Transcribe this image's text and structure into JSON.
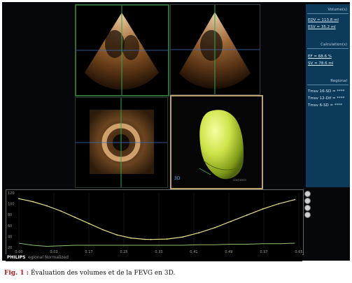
{
  "side_panel": {
    "volumes_title": "Volume(s)",
    "edv": "EDV = 113.8 ml",
    "esv": "ESV = 35.2 ml",
    "calc_title": "Calculation(s)",
    "ef": "EF = 68.6 %",
    "sv": "SV = 78.6 ml",
    "regional_title": "Regional",
    "regional_rows": [
      "Tmsv 16-SD = ****",
      "Tmsv 12-Dif = ****",
      "Tmsv 6-SD = ****"
    ]
  },
  "view_3d_label": "3D",
  "plot": {
    "y_ticks": [
      "120",
      "100",
      "80",
      "60",
      "40",
      "20"
    ],
    "x_ticks": [
      "0.00",
      "0.03",
      "0.17",
      "0.25",
      "0.33",
      "0.41",
      "0.49",
      "0.57",
      "0.65"
    ]
  },
  "footer": {
    "brand": "PHILIPS",
    "sub": "egional Normalized"
  },
  "caption": {
    "prefix": "Fig. 1 :",
    "text": " Évaluation des volumes et de la FEVG en 3D."
  },
  "chart_data": {
    "type": "line",
    "series": [
      {
        "values": [
          113.8,
          108,
          100,
          90,
          78,
          66,
          54,
          44,
          38,
          35.5,
          35.2,
          36,
          40,
          48,
          58,
          70,
          82,
          94,
          104,
          112
        ]
      },
      {
        "values": [
          28,
          24,
          22,
          23,
          24,
          24,
          24,
          24,
          24,
          24,
          24,
          24,
          24,
          25,
          25,
          26,
          26,
          27,
          27,
          28
        ]
      }
    ],
    "x": [
      0.0,
      0.035,
      0.07,
      0.105,
      0.14,
      0.175,
      0.21,
      0.245,
      0.28,
      0.315,
      0.33,
      0.37,
      0.41,
      0.45,
      0.49,
      0.53,
      0.57,
      0.61,
      0.65,
      0.69
    ],
    "xlim": [
      0,
      0.7
    ],
    "ylim": [
      20,
      125
    ]
  }
}
